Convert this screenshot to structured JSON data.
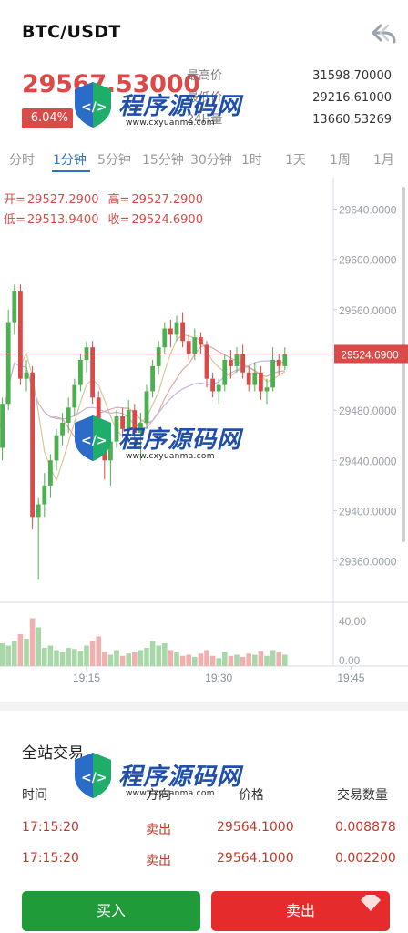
{
  "header": {
    "pair": "BTC/USDT"
  },
  "summary": {
    "last_price": "29567.53000",
    "change": "-6.04%",
    "stats": [
      {
        "label": "最高价",
        "value": "31598.70000"
      },
      {
        "label": "最低价",
        "value": "29216.61000"
      },
      {
        "label": "24H量",
        "value": "13660.53269"
      }
    ]
  },
  "tabs": [
    {
      "label": "分时",
      "active": false
    },
    {
      "label": "1分钟",
      "active": true
    },
    {
      "label": "5分钟",
      "active": false
    },
    {
      "label": "15分钟",
      "active": false
    },
    {
      "label": "30分钟",
      "active": false
    },
    {
      "label": "1时",
      "active": false
    },
    {
      "label": "1天",
      "active": false
    },
    {
      "label": "1周",
      "active": false
    },
    {
      "label": "1月",
      "active": false
    }
  ],
  "ohlc": {
    "open_label": "开=",
    "open": "29527.2900",
    "high_label": "高=",
    "high": "29527.2900",
    "low_label": "低=",
    "low": "29513.9400",
    "close_label": "收=",
    "close": "29524.6900"
  },
  "chart_data": {
    "type": "candlestick",
    "price_ticks": [
      "29640.0000",
      "29600.0000",
      "29560.0000",
      "29480.0000",
      "29440.0000",
      "29400.0000",
      "29360.0000"
    ],
    "price_ylim": [
      29330,
      29665
    ],
    "current_price_label": "29524.6900",
    "current_price": 29524.69,
    "volume_ticks": [
      "40.00",
      "0.00"
    ],
    "volume_ylim": [
      0,
      56
    ],
    "time_ticks": [
      {
        "label": "19:15",
        "index": 15
      },
      {
        "label": "19:30",
        "index": 37
      },
      {
        "label": "19:45",
        "index": 59
      }
    ],
    "candles": [
      {
        "o": 29480,
        "c": 29460,
        "h": 29495,
        "l": 29445
      },
      {
        "o": 29450,
        "c": 29485,
        "h": 29490,
        "l": 29440
      },
      {
        "o": 29485,
        "c": 29550,
        "h": 29560,
        "l": 29480
      },
      {
        "o": 29550,
        "c": 29575,
        "h": 29580,
        "l": 29540
      },
      {
        "o": 29575,
        "c": 29505,
        "h": 29580,
        "l": 29500
      },
      {
        "o": 29505,
        "c": 29510,
        "h": 29520,
        "l": 29495
      },
      {
        "o": 29510,
        "c": 29395,
        "h": 29515,
        "l": 29385
      },
      {
        "o": 29395,
        "c": 29405,
        "h": 29410,
        "l": 29345
      },
      {
        "o": 29405,
        "c": 29420,
        "h": 29430,
        "l": 29395
      },
      {
        "o": 29420,
        "c": 29440,
        "h": 29445,
        "l": 29410
      },
      {
        "o": 29440,
        "c": 29460,
        "h": 29465,
        "l": 29432
      },
      {
        "o": 29460,
        "c": 29470,
        "h": 29478,
        "l": 29452
      },
      {
        "o": 29470,
        "c": 29482,
        "h": 29490,
        "l": 29462
      },
      {
        "o": 29482,
        "c": 29500,
        "h": 29505,
        "l": 29475
      },
      {
        "o": 29500,
        "c": 29520,
        "h": 29525,
        "l": 29495
      },
      {
        "o": 29520,
        "c": 29530,
        "h": 29535,
        "l": 29510
      },
      {
        "o": 29530,
        "c": 29490,
        "h": 29535,
        "l": 29485
      },
      {
        "o": 29490,
        "c": 29460,
        "h": 29495,
        "l": 29455
      },
      {
        "o": 29460,
        "c": 29440,
        "h": 29465,
        "l": 29425
      },
      {
        "o": 29440,
        "c": 29455,
        "h": 29465,
        "l": 29420
      },
      {
        "o": 29455,
        "c": 29475,
        "h": 29480,
        "l": 29450
      },
      {
        "o": 29475,
        "c": 29465,
        "h": 29482,
        "l": 29458
      },
      {
        "o": 29465,
        "c": 29480,
        "h": 29488,
        "l": 29460
      },
      {
        "o": 29480,
        "c": 29462,
        "h": 29485,
        "l": 29455
      },
      {
        "o": 29462,
        "c": 29470,
        "h": 29478,
        "l": 29440
      },
      {
        "o": 29470,
        "c": 29495,
        "h": 29500,
        "l": 29465
      },
      {
        "o": 29495,
        "c": 29515,
        "h": 29520,
        "l": 29490
      },
      {
        "o": 29515,
        "c": 29530,
        "h": 29535,
        "l": 29508
      },
      {
        "o": 29530,
        "c": 29545,
        "h": 29550,
        "l": 29525
      },
      {
        "o": 29545,
        "c": 29540,
        "h": 29552,
        "l": 29530
      },
      {
        "o": 29540,
        "c": 29550,
        "h": 29555,
        "l": 29535
      },
      {
        "o": 29550,
        "c": 29535,
        "h": 29558,
        "l": 29530
      },
      {
        "o": 29535,
        "c": 29525,
        "h": 29540,
        "l": 29520
      },
      {
        "o": 29525,
        "c": 29538,
        "h": 29545,
        "l": 29520
      },
      {
        "o": 29538,
        "c": 29532,
        "h": 29542,
        "l": 29525
      },
      {
        "o": 29532,
        "c": 29505,
        "h": 29535,
        "l": 29498
      },
      {
        "o": 29505,
        "c": 29495,
        "h": 29510,
        "l": 29490
      },
      {
        "o": 29495,
        "c": 29500,
        "h": 29505,
        "l": 29485
      },
      {
        "o": 29500,
        "c": 29520,
        "h": 29525,
        "l": 29495
      },
      {
        "o": 29520,
        "c": 29515,
        "h": 29528,
        "l": 29505
      },
      {
        "o": 29515,
        "c": 29525,
        "h": 29530,
        "l": 29510
      },
      {
        "o": 29525,
        "c": 29510,
        "h": 29532,
        "l": 29505
      },
      {
        "o": 29510,
        "c": 29500,
        "h": 29515,
        "l": 29495
      },
      {
        "o": 29500,
        "c": 29510,
        "h": 29518,
        "l": 29495
      },
      {
        "o": 29510,
        "c": 29495,
        "h": 29515,
        "l": 29488
      },
      {
        "o": 29495,
        "c": 29498,
        "h": 29505,
        "l": 29485
      },
      {
        "o": 29498,
        "c": 29520,
        "h": 29530,
        "l": 29495
      },
      {
        "o": 29520,
        "c": 29515,
        "h": 29525,
        "l": 29508
      },
      {
        "o": 29515,
        "c": 29525,
        "h": 29530,
        "l": 29512
      }
    ],
    "volumes": [
      12,
      20,
      18,
      22,
      28,
      24,
      42,
      34,
      16,
      18,
      14,
      12,
      16,
      15,
      13,
      18,
      22,
      26,
      12,
      10,
      14,
      9,
      11,
      12,
      14,
      16,
      22,
      18,
      20,
      14,
      12,
      9,
      10,
      8,
      11,
      14,
      9,
      7,
      12,
      9,
      10,
      8,
      11,
      10,
      13,
      9,
      14,
      12,
      10
    ]
  },
  "trades": {
    "title": "全站交易",
    "headers": {
      "time": "时间",
      "direction": "方向",
      "price": "价格",
      "qty": "交易数量"
    },
    "rows": [
      {
        "time": "17:15:20",
        "direction": "卖出",
        "price": "29564.1000",
        "qty": "0.008878"
      },
      {
        "time": "17:15:20",
        "direction": "卖出",
        "price": "29564.1000",
        "qty": "0.002200"
      }
    ]
  },
  "actions": {
    "buy": "买入",
    "sell": "卖出"
  },
  "colors": {
    "up": "#4caf50",
    "down": "#d94a48",
    "accent": "#2f72c8",
    "buy": "#1f9b3a",
    "sell": "#e52b2b"
  },
  "watermark": {
    "text": "程序源码网",
    "url": "www.cxyuanma.com"
  }
}
